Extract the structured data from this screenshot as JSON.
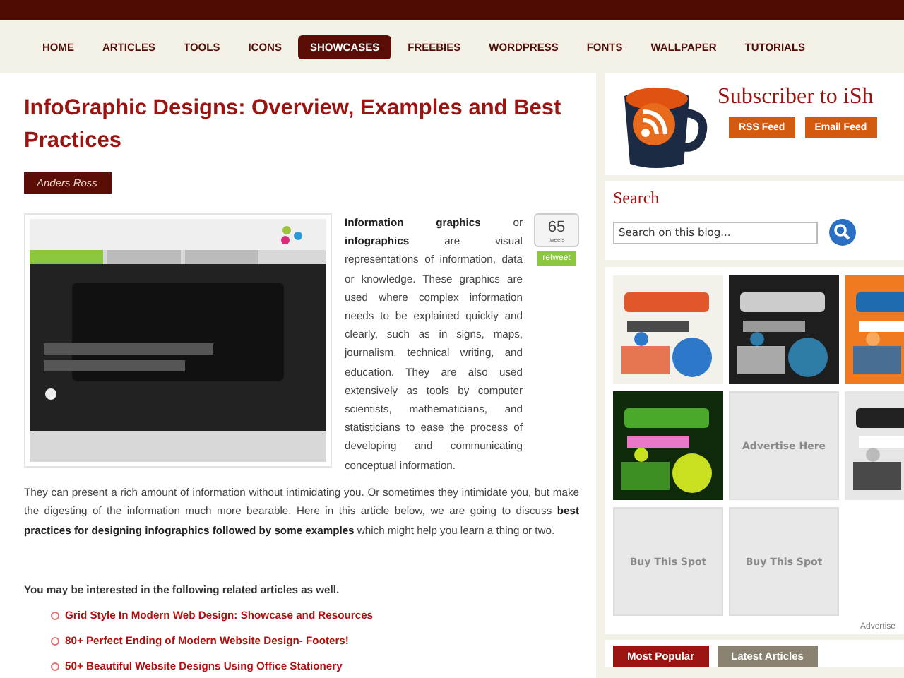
{
  "nav": [
    {
      "label": "HOME",
      "selected": false
    },
    {
      "label": "ARTICLES",
      "selected": false
    },
    {
      "label": "TOOLS",
      "selected": false
    },
    {
      "label": "ICONS",
      "selected": false
    },
    {
      "label": "SHOWCASES",
      "selected": true
    },
    {
      "label": "FREEBIES",
      "selected": false
    },
    {
      "label": "WORDPRESS",
      "selected": false
    },
    {
      "label": "FONTS",
      "selected": false
    },
    {
      "label": "WALLPAPER",
      "selected": false
    },
    {
      "label": "TUTORIALS",
      "selected": false
    }
  ],
  "article": {
    "title": "InfoGraphic Designs: Overview, Examples and Best Practices",
    "author": "Anders Ross",
    "image": {
      "kind": "picture"
    },
    "tweet": {
      "count": "65",
      "unit": "tweets",
      "button": "retweet"
    },
    "paragraphs": [
      "**Information graphics** or **infographics** are visual representations of information, data or knowledge. These graphics are used where complex information needs to be explained quickly and clearly, such as in signs, maps, journalism, technical writing, and education. They are also used extensively as tools by computer scientists, mathematicians, and statisticians to ease the process of developing and communicating conceptual information.",
      "They can present a rich amount of information without intimidating you. Or sometimes they intimidate you, but make the digesting of the information much more bearable. Here in this article below, we are going to discuss **best practices for designing infographics followed by some examples** which might help you learn a thing or two."
    ],
    "related_heading": "You may be interested in the following related articles as well.",
    "related": [
      "Grid Style In Modern Web Design: Showcase and Resources",
      "80+ Perfect Ending of Modern Website Design- Footers!",
      "50+ Beautiful Website Designs Using Office Stationery"
    ]
  },
  "sidebar": {
    "subscribe_title": "Subscriber to iSh",
    "buttons": [
      "RSS Feed",
      "Email Feed"
    ],
    "search_title": "Search",
    "search_placeholder": "Search on this blog...",
    "ads": [
      {
        "kind": "picture"
      },
      {
        "kind": "picture"
      },
      {
        "kind": "picture"
      },
      {
        "kind": "picture"
      },
      {
        "kind": "spot",
        "label": "Advertise Here"
      },
      {
        "kind": "picture"
      },
      {
        "kind": "spot",
        "label": "Buy This Spot"
      },
      {
        "kind": "spot",
        "label": "Buy This Spot"
      }
    ],
    "advertise_link": "Advertise",
    "tabs": [
      {
        "label": "Most Popular",
        "selected": true
      },
      {
        "label": "Latest Articles",
        "selected": false
      }
    ]
  }
}
